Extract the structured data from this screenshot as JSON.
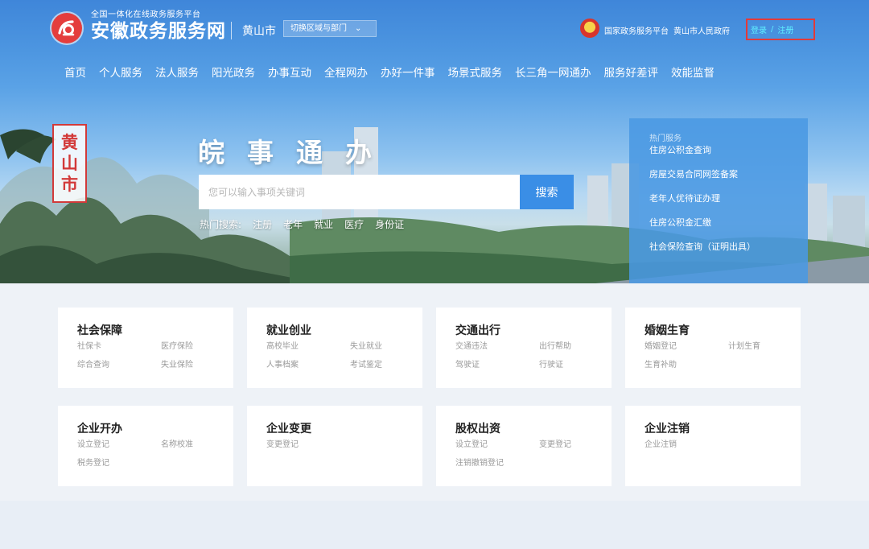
{
  "header": {
    "logo_sub": "全国一体化在线政务服务平台",
    "logo_main": "安徽政务服务网",
    "city": "黄山市",
    "region_switch": "切换区域与部门",
    "gov_link_1": "国家政务服务平台",
    "gov_link_2": "黄山市人民政府",
    "login": "登录",
    "separator": "/",
    "register": "注册"
  },
  "nav": {
    "items": [
      "首页",
      "个人服务",
      "法人服务",
      "阳光政务",
      "办事互动",
      "全程网办",
      "办好一件事",
      "场景式服务",
      "长三角一网通办",
      "服务好差评",
      "效能监督"
    ]
  },
  "hero": {
    "seal_chars": [
      "黄",
      "山",
      "市"
    ],
    "title": "皖事通办",
    "search_placeholder": "您可以输入事项关键词",
    "search_button": "搜索",
    "hot_label": "热门搜索:",
    "hot_terms": [
      "注册",
      "老年",
      "就业",
      "医疗",
      "身份证"
    ]
  },
  "hot_services": {
    "title": "热门服务",
    "items": [
      "住房公积金查询",
      "房屋交易合同网签备案",
      "老年人优待证办理",
      "住房公积金汇缴",
      "社会保险查询（证明出具）"
    ]
  },
  "cards": [
    {
      "title": "社会保障",
      "links": [
        "社保卡",
        "医疗保险",
        "综合查询",
        "失业保险"
      ]
    },
    {
      "title": "就业创业",
      "links": [
        "高校毕业",
        "失业就业",
        "人事档案",
        "考试鉴定"
      ]
    },
    {
      "title": "交通出行",
      "links": [
        "交通违法",
        "出行帮助",
        "驾驶证",
        "行驶证"
      ]
    },
    {
      "title": "婚姻生育",
      "links": [
        "婚姻登记",
        "计划生育",
        "生育补助"
      ]
    },
    {
      "title": "企业开办",
      "links": [
        "设立登记",
        "名称校准",
        "税务登记"
      ]
    },
    {
      "title": "企业变更",
      "links": [
        "变更登记"
      ]
    },
    {
      "title": "股权出资",
      "links": [
        "设立登记",
        "变更登记",
        "注销撤销登记"
      ]
    },
    {
      "title": "企业注销",
      "links": [
        "企业注销"
      ]
    }
  ],
  "colors": {
    "header_blue": "#3f86d9",
    "search_button": "#3a8ee6",
    "login_highlight": "#e23a3a",
    "seal_red": "#d23a3a"
  }
}
